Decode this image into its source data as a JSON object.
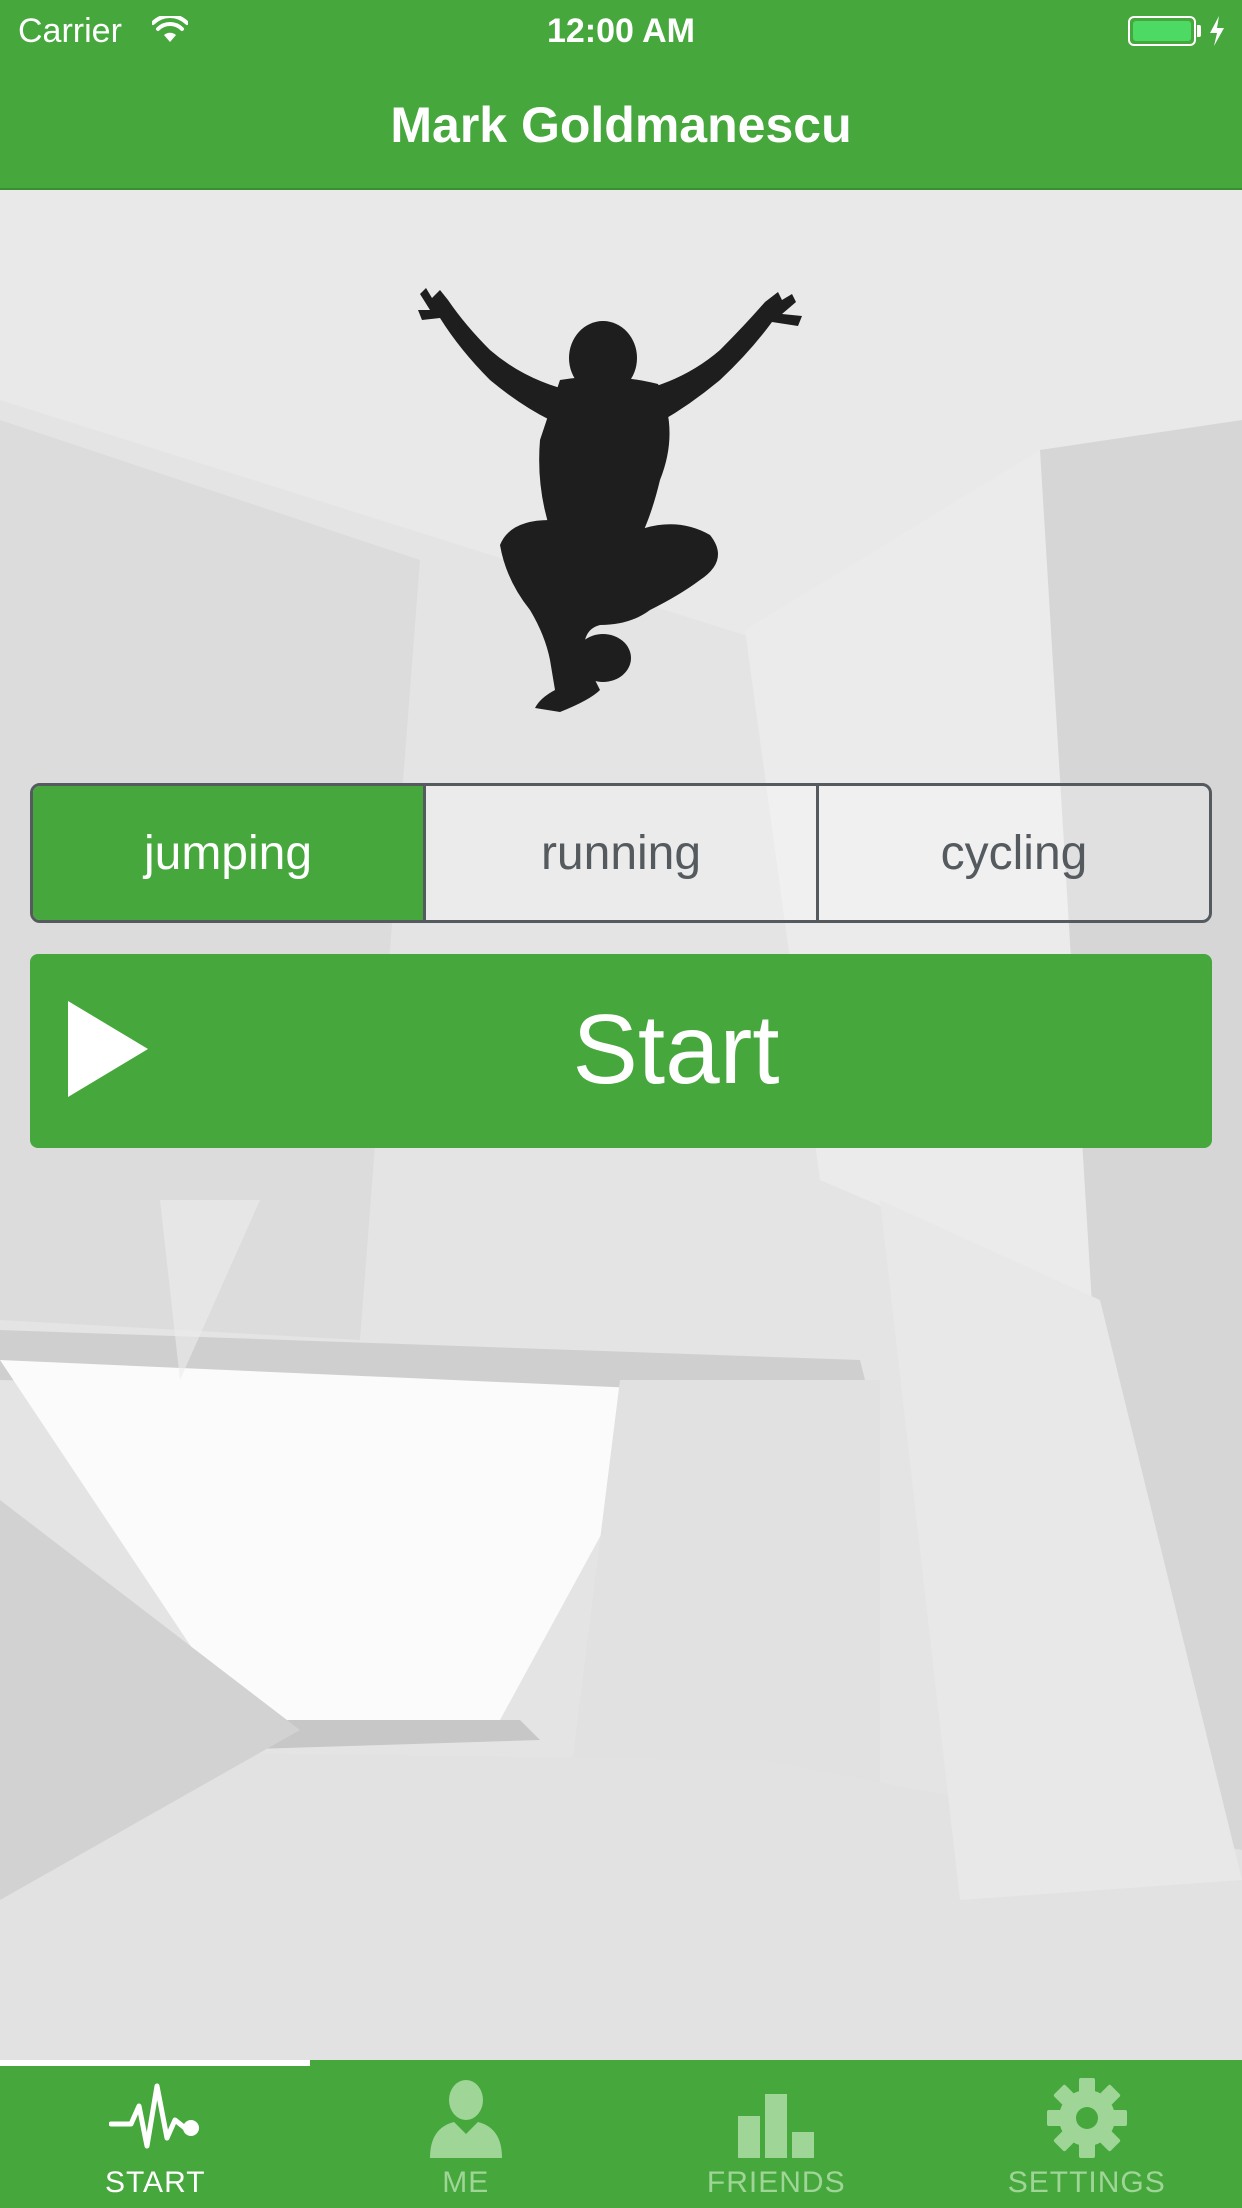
{
  "status_bar": {
    "carrier": "Carrier",
    "time": "12:00 AM",
    "battery_color": "#4cd964"
  },
  "nav": {
    "title": "Mark Goldmanescu"
  },
  "activity": {
    "image_icon": "jumping-person-silhouette",
    "segments": [
      {
        "label": "jumping",
        "selected": true
      },
      {
        "label": "running",
        "selected": false
      },
      {
        "label": "cycling",
        "selected": false
      }
    ]
  },
  "start_button": {
    "label": "Start",
    "icon": "play-icon"
  },
  "tabbar": {
    "tabs": [
      {
        "label": "START",
        "icon": "heartbeat-icon",
        "active": true
      },
      {
        "label": "ME",
        "icon": "person-icon",
        "active": false
      },
      {
        "label": "FRIENDS",
        "icon": "bar-chart-icon",
        "active": false
      },
      {
        "label": "SETTINGS",
        "icon": "gear-icon",
        "active": false
      }
    ]
  },
  "colors": {
    "accent": "#46a83c",
    "segment_border": "#555a5f",
    "tab_inactive": "#9fd597"
  }
}
